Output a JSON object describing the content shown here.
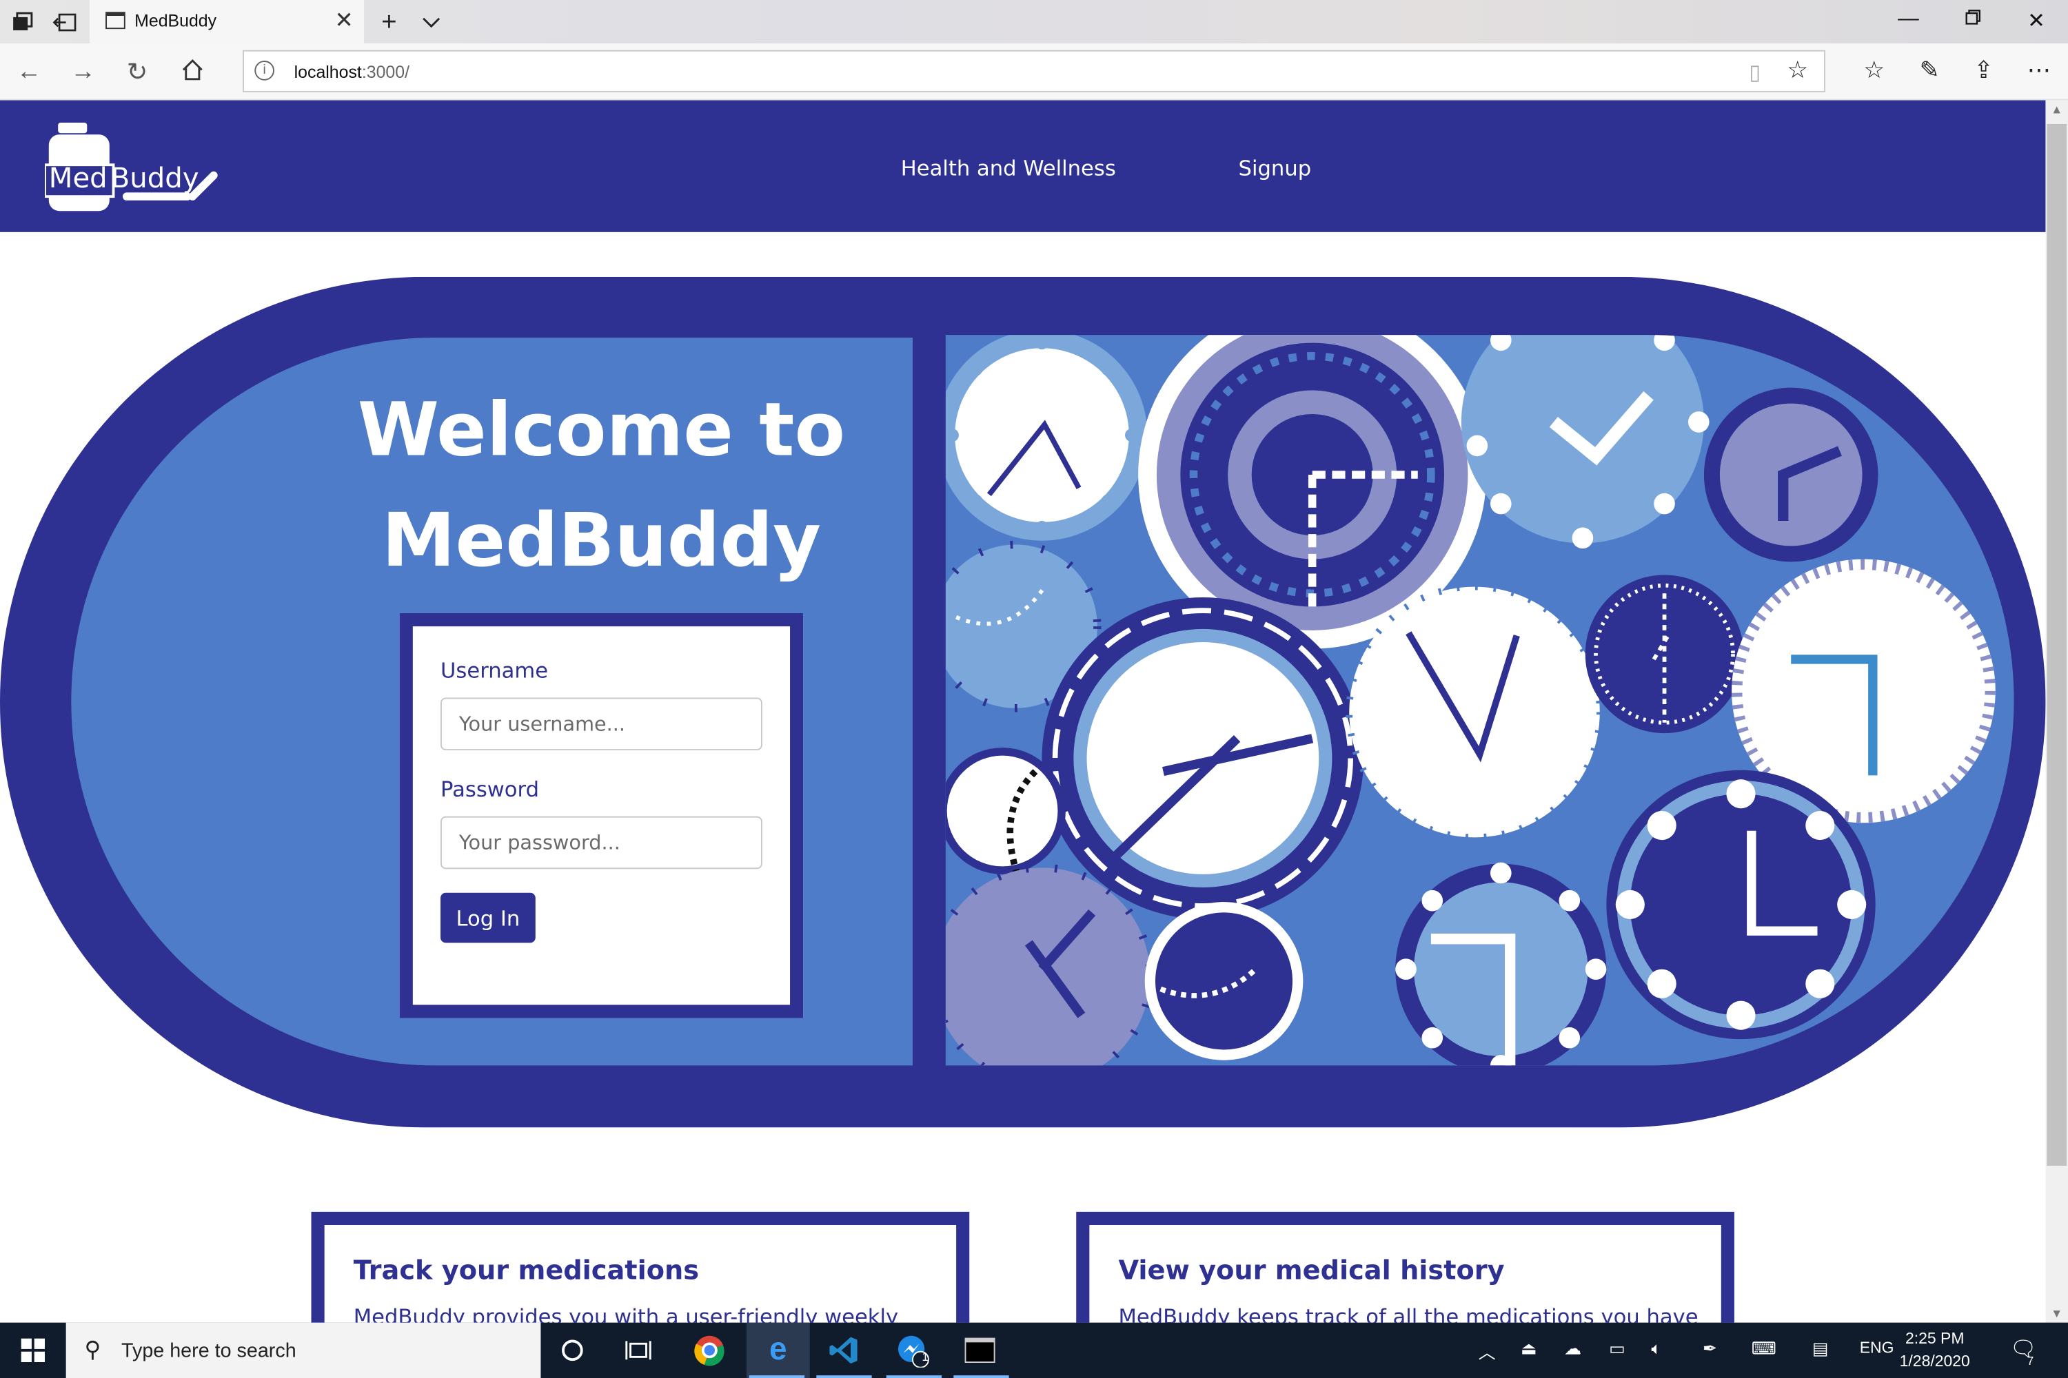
{
  "browser": {
    "tab_title": "MedBuddy",
    "url_host": "localhost",
    "url_rest": ":3000/"
  },
  "site": {
    "logo_text_1": "Med",
    "logo_text_2": "Buddy",
    "nav": [
      "Health and Wellness",
      "Signup"
    ]
  },
  "hero": {
    "welcome_line1": "Welcome to",
    "welcome_line2": "MedBuddy"
  },
  "login": {
    "username_label": "Username",
    "username_placeholder": "Your username...",
    "password_label": "Password",
    "password_placeholder": "Your password...",
    "button": "Log In"
  },
  "features": [
    {
      "title": "Track your medications",
      "text": "MedBuddy provides you with a user-friendly weekly"
    },
    {
      "title": "View your medical history",
      "text": "MedBuddy keeps track of all the medications you have"
    }
  ],
  "taskbar": {
    "search_placeholder": "Type here to search",
    "language": "ENG",
    "time": "2:25 PM",
    "date": "1/28/2020",
    "messenger_badge": "1",
    "notification_count": "7"
  },
  "colors": {
    "brand": "#2e3192",
    "brand_light": "#4e7cc8",
    "accent_light": "#7ba7db",
    "lavender": "#8a8fc8"
  }
}
